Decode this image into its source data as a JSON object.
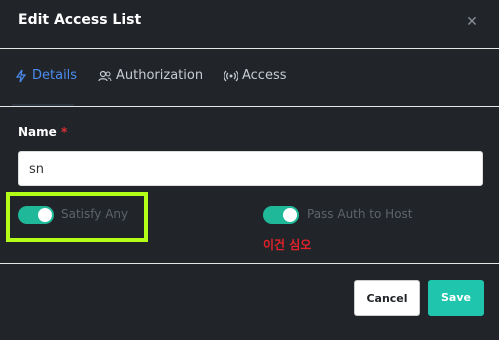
{
  "dialog": {
    "title": "Edit Access List",
    "close_icon": "close-icon"
  },
  "tabs": [
    {
      "label": "Details",
      "icon": "lightning-icon",
      "active": true
    },
    {
      "label": "Authorization",
      "icon": "users-icon",
      "active": false
    },
    {
      "label": "Access",
      "icon": "broadcast-icon",
      "active": false
    }
  ],
  "form": {
    "name_label": "Name",
    "required_mark": "*",
    "name_value": "sn"
  },
  "toggles": [
    {
      "label": "Satisfy Any",
      "on": true
    },
    {
      "label": "Pass Auth to Host",
      "on": true
    }
  ],
  "annotation": {
    "note": "이건 심오",
    "highlight_color": "#b3ff1a",
    "note_color": "#e1222a"
  },
  "buttons": {
    "cancel": "Cancel",
    "save": "Save"
  },
  "colors": {
    "accent_tab": "#4b8cf0",
    "toggle_on": "#1fb99a",
    "save_bg": "#1fc6ad"
  }
}
